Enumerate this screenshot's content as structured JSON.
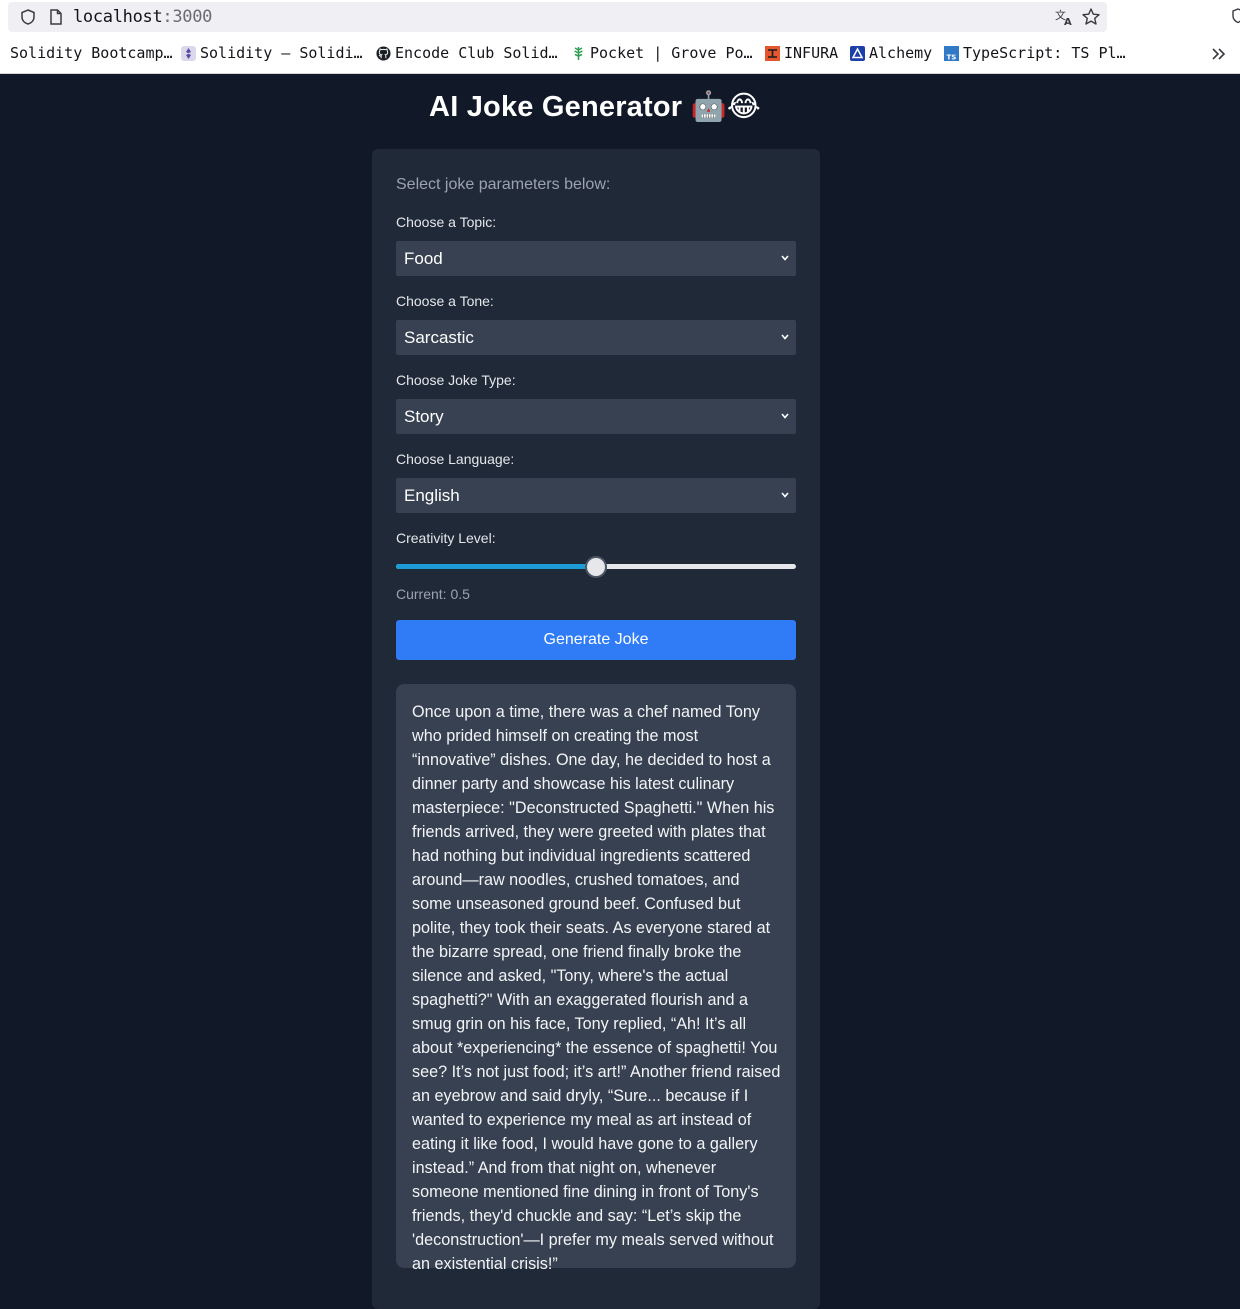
{
  "browser": {
    "url_host": "localhost",
    "url_port": ":3000",
    "bookmarks": [
      {
        "label": "Solidity Bootcamp…",
        "icon": "bookmark-folder-icon"
      },
      {
        "label": "Solidity — Solidi…",
        "icon": "solidity-logo-icon"
      },
      {
        "label": "Encode Club Solid…",
        "icon": "github-icon"
      },
      {
        "label": "Pocket | Grove Po…",
        "icon": "pocket-grove-icon"
      },
      {
        "label": "INFURA",
        "icon": "infura-icon"
      },
      {
        "label": "Alchemy",
        "icon": "alchemy-icon"
      },
      {
        "label": "TypeScript: TS Pl…",
        "icon": "typescript-icon"
      }
    ]
  },
  "app": {
    "title": "AI Joke Generator",
    "title_emoji": "🤖😂",
    "subtitle": "Select joke parameters below:",
    "topic": {
      "label": "Choose a Topic:",
      "value": "Food"
    },
    "tone": {
      "label": "Choose a Tone:",
      "value": "Sarcastic"
    },
    "type": {
      "label": "Choose Joke Type:",
      "value": "Story"
    },
    "language": {
      "label": "Choose Language:",
      "value": "English"
    },
    "creativity": {
      "label": "Creativity Level:",
      "current_text": "Current: 0.5",
      "value": 0.5,
      "min": 0,
      "max": 1
    },
    "generate_label": "Generate Joke",
    "joke": "Once upon a time, there was a chef named Tony who prided himself on creating the most “innovative” dishes. One day, he decided to host a dinner party and showcase his latest culinary masterpiece: \"Deconstructed Spaghetti.\" When his friends arrived, they were greeted with plates that had nothing but individual ingredients scattered around—raw noodles, crushed tomatoes, and some unseasoned ground beef. Confused but polite, they took their seats. As everyone stared at the bizarre spread, one friend finally broke the silence and asked, \"Tony, where's the actual spaghetti?\" With an exaggerated flourish and a smug grin on his face, Tony replied, “Ah! It’s all about *experiencing* the essence of spaghetti! You see? It’s not just food; it’s art!” Another friend raised an eyebrow and said dryly, “Sure... because if I wanted to experience my meal as art instead of eating it like food, I would have gone to a gallery instead.” And from that night on, whenever someone mentioned fine dining in front of Tony's friends, they'd chuckle and say: “Let’s skip the 'deconstruction'—I prefer my meals served without an existential crisis!”"
  },
  "colors": {
    "page_bg": "#111827",
    "card_bg": "#1f2937",
    "input_bg": "#374151",
    "accent_button": "#2f7cf6",
    "slider_fill": "#1d9bd6"
  }
}
